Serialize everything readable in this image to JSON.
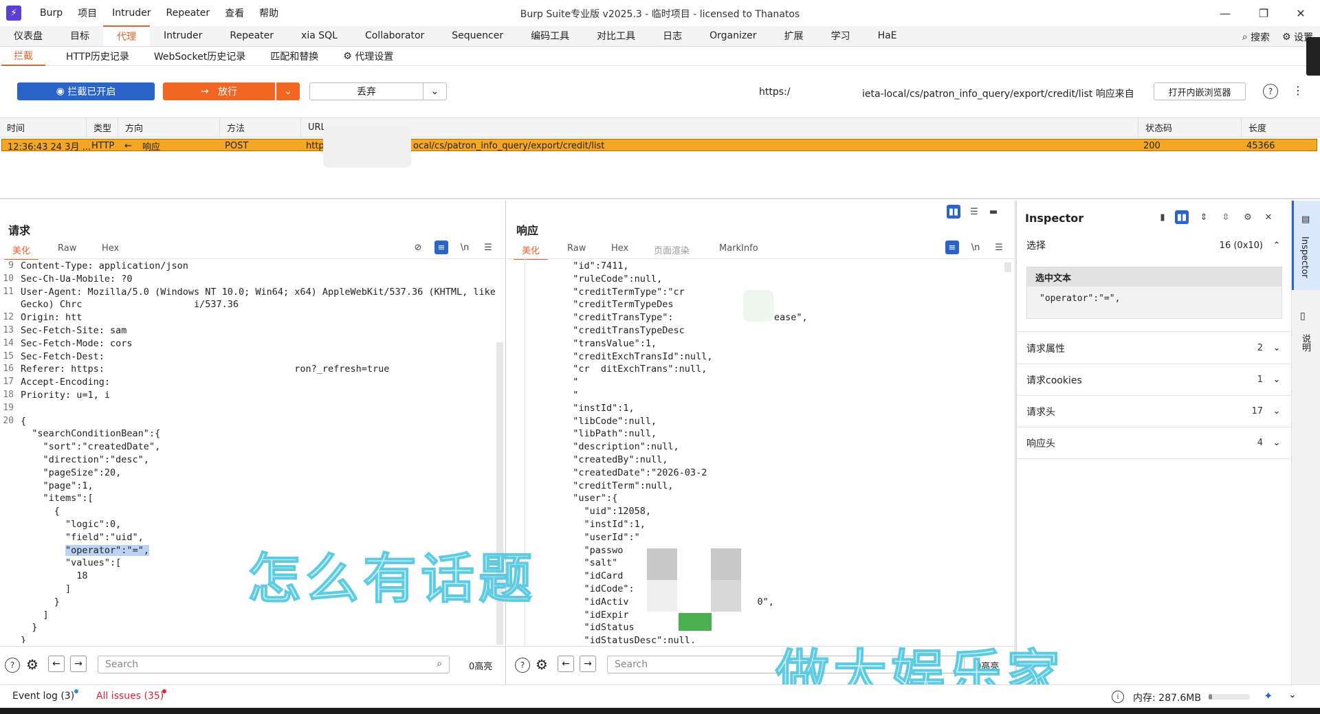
{
  "titlebar": {
    "menus": [
      "Burp",
      "项目",
      "Intruder",
      "Repeater",
      "查看",
      "帮助"
    ],
    "title": "Burp Suite专业版  v2025.3 - 临时项目 - licensed to Thanatos"
  },
  "main_tabs": [
    "仪表盘",
    "目标",
    "代理",
    "Intruder",
    "Repeater",
    "xia SQL",
    "Collaborator",
    "Sequencer",
    "编码工具",
    "对比工具",
    "日志",
    "Organizer",
    "扩展",
    "学习",
    "HaE"
  ],
  "main_tabs_active": "代理",
  "top_right": {
    "search": "搜索",
    "settings": "设置"
  },
  "sub_tabs": [
    "拦截",
    "HTTP历史记录",
    "WebSocket历史记录",
    "匹配和替换",
    "代理设置"
  ],
  "toolbar": {
    "intercept_label": "拦截已开启",
    "forward_label": "放行",
    "drop_label": "丢弃",
    "url_prefix": "https:/",
    "url_suffix": "ieta-local/cs/patron_info_query/export/credit/list 响应来自",
    "open_browser": "打开内嵌浏览器"
  },
  "history": {
    "columns": [
      "时间",
      "类型",
      "方向",
      "方法",
      "URL",
      "状态码",
      "长度"
    ],
    "row": {
      "time": "12:36:43 24 3月 ...",
      "type": "HTTP",
      "direction": "响应",
      "method": "POST",
      "url_prefix": "http",
      "url_suffix": "ocal/cs/patron_info_query/export/credit/list",
      "status": "200",
      "length": "45366"
    }
  },
  "request": {
    "title": "请求",
    "tabs": [
      "美化",
      "Raw",
      "Hex"
    ],
    "line_numbers": [
      "9",
      "10",
      "11",
      "",
      "12",
      "13",
      "14",
      "15",
      "16",
      "17",
      "18",
      "19",
      "20",
      "",
      "",
      "",
      "",
      "",
      "",
      "",
      "",
      "",
      "",
      "",
      "",
      "",
      "",
      "",
      "",
      ""
    ],
    "lines": [
      "Content-Type: application/json",
      "Sec-Ch-Ua-Mobile: ?0",
      "User-Agent: Mozilla/5.0 (Windows NT 10.0; Win64; x64) AppleWebKit/537.36 (KHTML, like",
      "Gecko) Chrc                    i/537.36",
      "Origin: htt",
      "Sec-Fetch-Site: sam",
      "Sec-Fetch-Mode: cors",
      "Sec-Fetch-Dest:",
      "Referer: https:                                  ron?_refresh=true",
      "Accept-Encoding:",
      "Priority: u=1, i",
      "",
      "{",
      "  \"searchConditionBean\":{",
      "    \"sort\":\"createdDate\",",
      "    \"direction\":\"desc\",",
      "    \"pageSize\":20,",
      "    \"page\":1,",
      "    \"items\":[",
      "      {",
      "        \"logic\":0,",
      "        \"field\":\"uid\",",
      "        \"operator\":\"=\",",
      "        \"values\":[",
      "          18",
      "        ]",
      "      }",
      "    ]",
      "  }",
      "}"
    ],
    "search_placeholder": "Search",
    "highlights": "0高亮"
  },
  "response": {
    "title": "响应",
    "tabs": [
      "美化",
      "Raw",
      "Hex",
      "页面渲染",
      "MarkInfo"
    ],
    "lines": [
      "  \"id\":7411,",
      "  \"ruleCode\":null,",
      "  \"creditTermType\":\"cr                 ",
      "  \"creditTermTypeDes",
      "  \"creditTransType\":                  ease\",",
      "  \"creditTransTypeDesc",
      "  \"transValue\":1,",
      "  \"creditExchTransId\":null,",
      "  \"cr  ditExchTrans\":null,",
      "  \"",
      "  \"",
      "  \"instId\":1,",
      "  \"libCode\":null,",
      "  \"libPath\":null,",
      "  \"description\":null,",
      "  \"createdBy\":null,",
      "  \"createdDate\":\"2026-03-2",
      "  \"creditTerm\":null,",
      "  \"user\":{",
      "    \"uid\":12058,",
      "    \"instId\":1,",
      "    \"userId\":\"",
      "    \"passwo",
      "    \"salt\"",
      "    \"idCard",
      "    \"idCode\":",
      "    \"idActiv                       0\",",
      "    \"idExpir",
      "    \"idStatus",
      "    \"idStatusDesc\":null,"
    ],
    "search_placeholder": "Search",
    "highlights": "0高亮"
  },
  "inspector": {
    "title": "Inspector",
    "selection_label": "选择",
    "selection_value": "16 (0x10)",
    "selected_text_label": "选中文本",
    "selected_text": "\"operator\":\"=\",",
    "sections": [
      {
        "label": "请求属性",
        "count": "2"
      },
      {
        "label": "请求cookies",
        "count": "1"
      },
      {
        "label": "请求头",
        "count": "17"
      },
      {
        "label": "响应头",
        "count": "4"
      }
    ],
    "side_tabs": [
      "Inspector",
      "说明"
    ]
  },
  "statusbar": {
    "event_log": "Event log (3)",
    "issues": "All issues (35)",
    "memory": "内存: 287.6MB"
  },
  "watermarks": {
    "w1": "怎么有话题",
    "w2": "做大娱乐家"
  },
  "colors": {
    "accent": "#e8612c",
    "blue": "#2b64c9",
    "row_highlight": "#f5a623"
  }
}
